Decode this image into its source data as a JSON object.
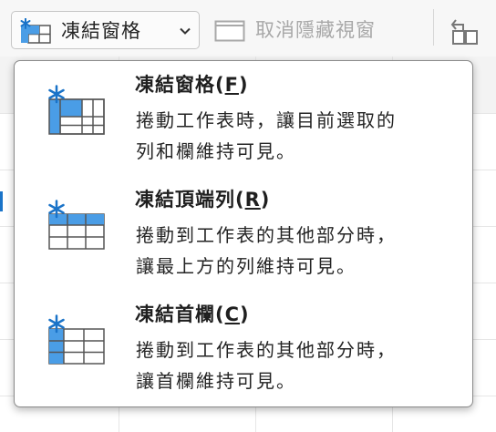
{
  "toolbar": {
    "freeze_panes_label": "凍結窗格",
    "unhide_label": "取消隱藏視窗"
  },
  "menu": {
    "items": [
      {
        "title": "凍結窗格",
        "accesskey": "F",
        "description_line1": "捲動工作表時，讓目前選取的",
        "description_line2": "列和欄維持可見。",
        "icon": "freeze-panes-icon"
      },
      {
        "title": "凍結頂端列",
        "accesskey": "R",
        "description_line1": "捲動到工作表的其他部分時，",
        "description_line2": "讓最上方的列維持可見。",
        "icon": "freeze-top-row-icon"
      },
      {
        "title": "凍結首欄",
        "accesskey": "C",
        "description_line1": "捲動到工作表的其他部分時，",
        "description_line2": "讓首欄維持可見。",
        "icon": "freeze-first-column-icon"
      }
    ]
  },
  "colors": {
    "accent": "#1a73c8",
    "icon_fill": "#4a9de6",
    "icon_light": "#cfe3f7"
  }
}
